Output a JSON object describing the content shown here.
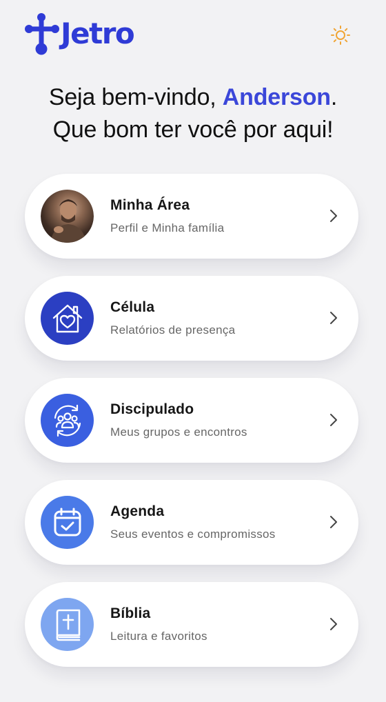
{
  "header": {
    "logo_text": "Jetro",
    "theme_icon": "sun-icon"
  },
  "greeting": {
    "prefix": "Seja bem-vindo, ",
    "user_name": "Anderson",
    "suffix": ".",
    "line2": "Que bom ter você por aqui!"
  },
  "menu": [
    {
      "title": "Minha Área",
      "subtitle": "Perfil e Minha família",
      "icon": "avatar-photo",
      "color": "#5a4336"
    },
    {
      "title": "Célula",
      "subtitle": "Relatórios de presença",
      "icon": "house-heart-icon",
      "color": "#2b3fc2"
    },
    {
      "title": "Discipulado",
      "subtitle": "Meus grupos e encontros",
      "icon": "group-cycle-icon",
      "color": "#3a5fe0"
    },
    {
      "title": "Agenda",
      "subtitle": "Seus eventos e compromissos",
      "icon": "calendar-check-icon",
      "color": "#4a7ae8"
    },
    {
      "title": "Bíblia",
      "subtitle": "Leitura e favoritos",
      "icon": "bible-icon",
      "color": "#7ea6f0"
    }
  ],
  "colors": {
    "brand": "#2f3bd6",
    "accent_sun": "#f0a535",
    "background": "#f2f2f4"
  }
}
